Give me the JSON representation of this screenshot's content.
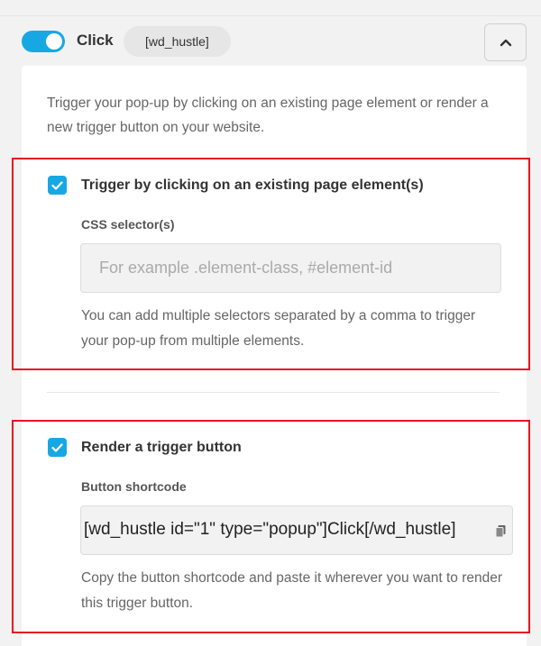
{
  "header": {
    "toggle_label": "Click",
    "tag": "[wd_hustle]"
  },
  "panel": {
    "intro": "Trigger your pop-up by clicking on an existing page element or render a new trigger button on your website.",
    "existing_element": {
      "label": "Trigger by clicking on an existing page element(s)",
      "field_label": "CSS selector(s)",
      "placeholder": "For example .element-class, #element-id",
      "value": "",
      "help": "You can add multiple selectors separated by a comma to trigger your pop-up from multiple elements."
    },
    "trigger_button": {
      "label": "Render a trigger button",
      "field_label": "Button shortcode",
      "shortcode": "[wd_hustle id=\"1\" type=\"popup\"]Click[/wd_hustle]",
      "help": "Copy the button shortcode and paste it wherever you want to render this trigger button."
    }
  },
  "icons": {
    "collapse": "chevron-up-icon",
    "check": "checkmark-icon",
    "copy": "copy-icon"
  },
  "colors": {
    "accent": "#17a8e3",
    "highlight": "#e81123"
  }
}
